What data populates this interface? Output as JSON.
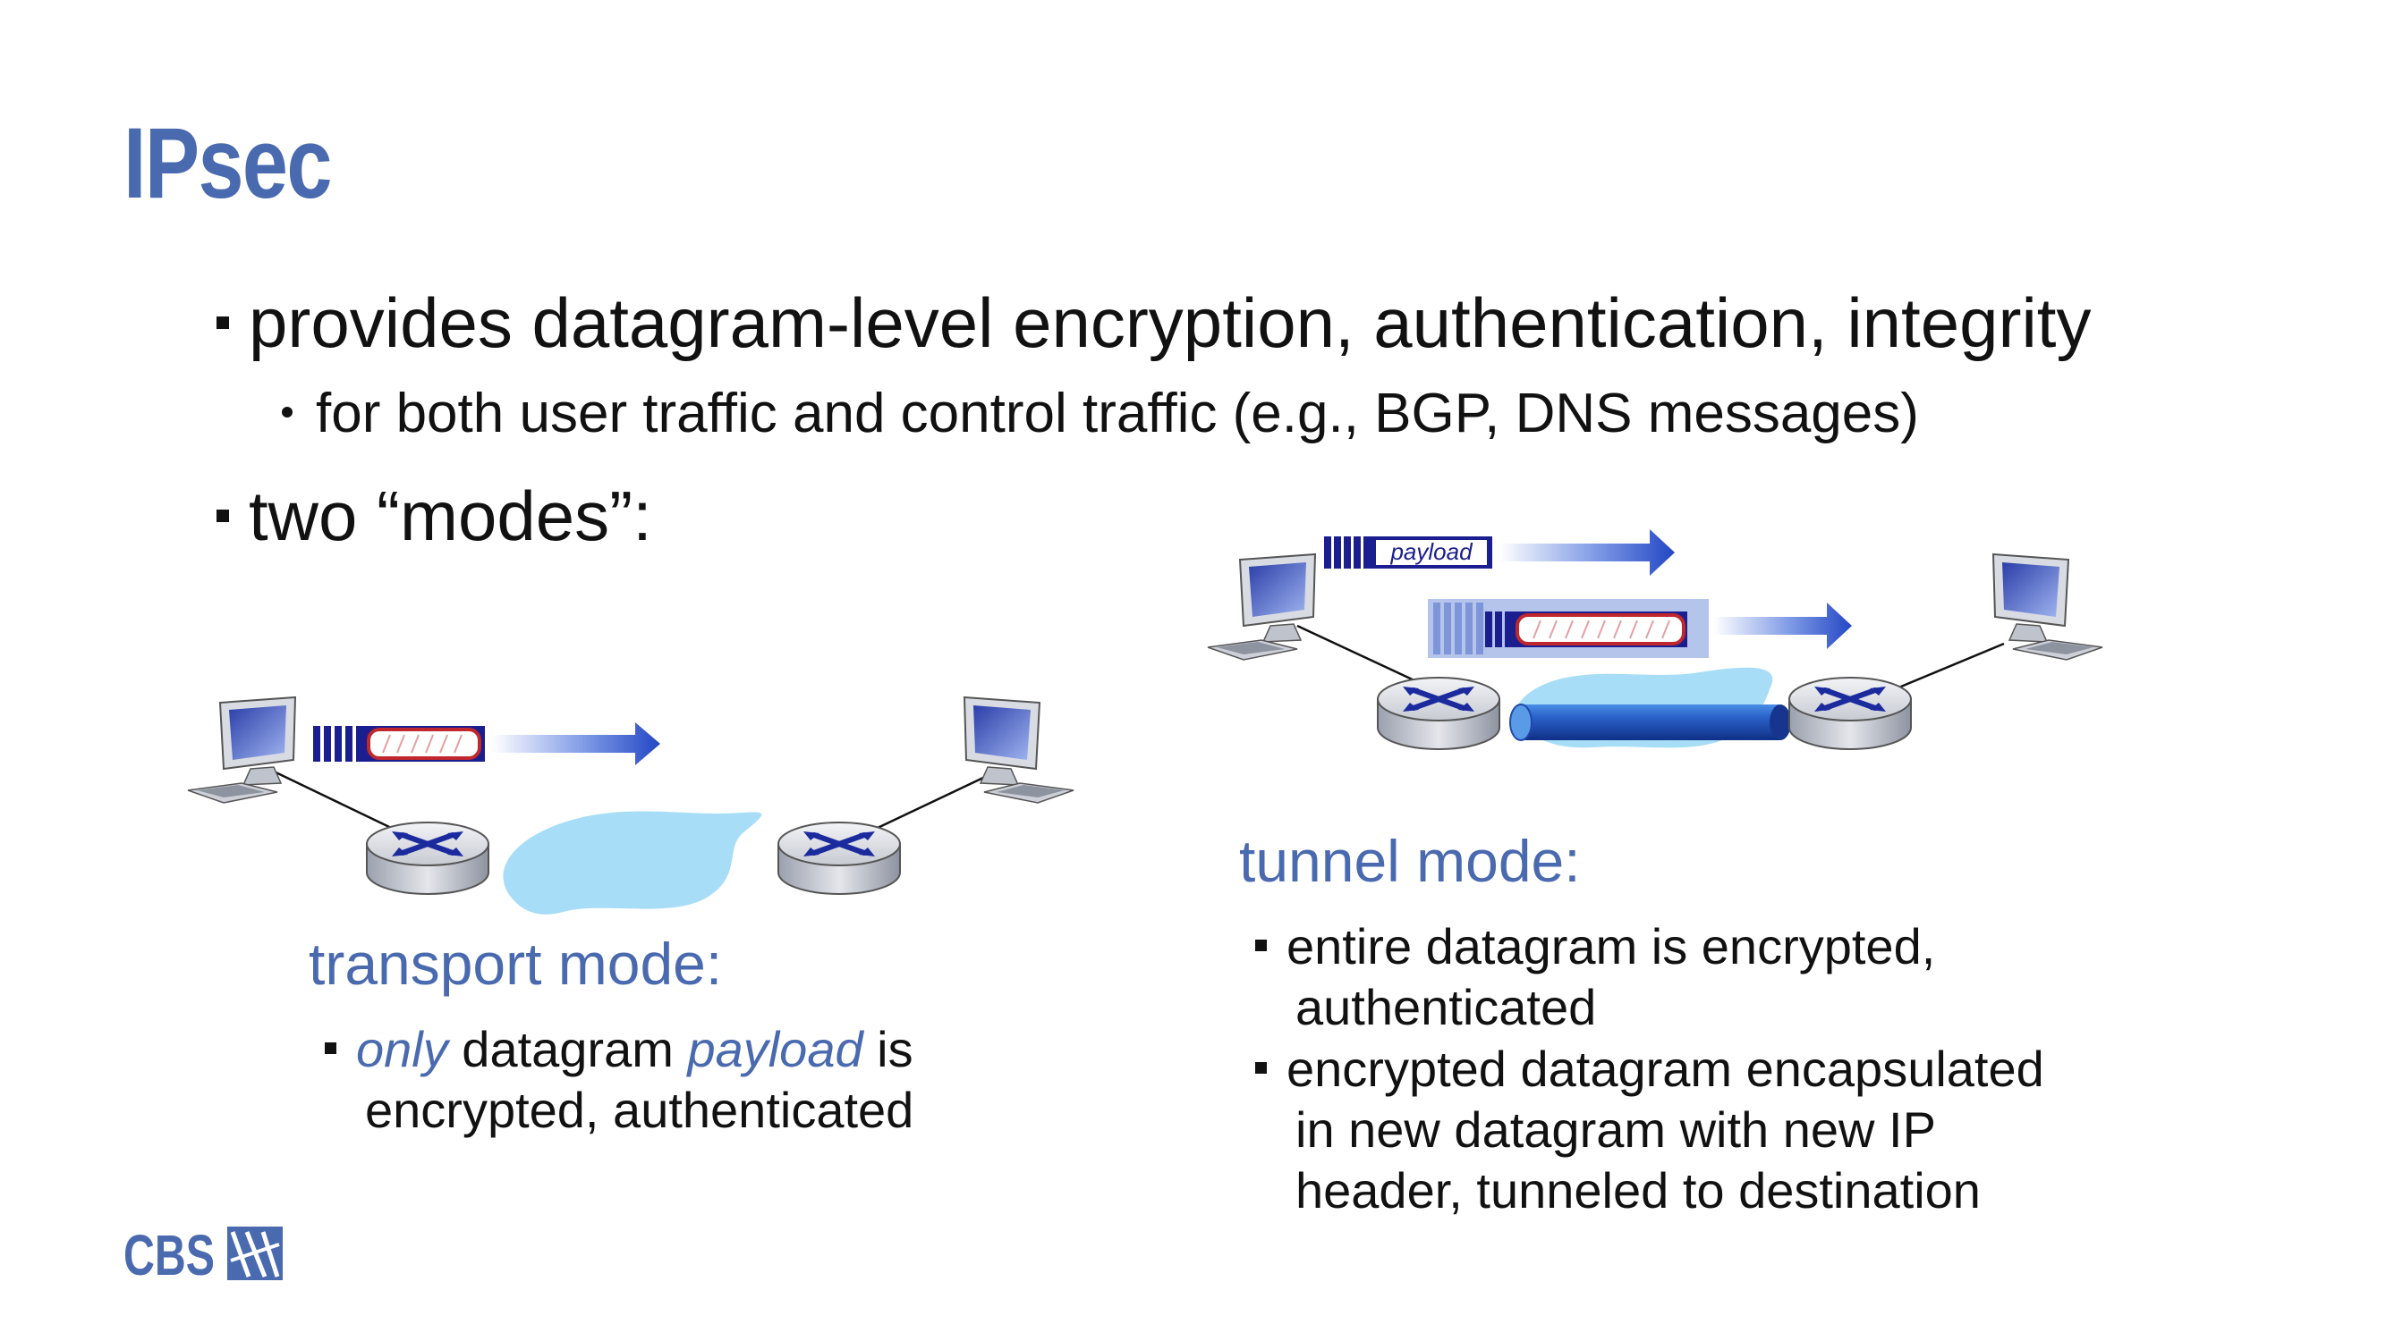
{
  "slide": {
    "title": "IPsec",
    "bullets": [
      "provides datagram-level encryption, authentication, integrity",
      "two “modes”:"
    ],
    "sub_bullet": "for both user traffic and control traffic (e.g., BGP, DNS messages)"
  },
  "transport": {
    "title": "transport mode:",
    "only": "only",
    "datagram": " datagram ",
    "payload": "payload",
    "is": " is",
    "line2": "encrypted, authenticated"
  },
  "tunnel": {
    "title": "tunnel mode:",
    "payload_label": "payload",
    "b1_line1": "entire datagram is encrypted,",
    "b1_line2": "authenticated",
    "b2_line1": "encrypted datagram encapsulated",
    "b2_line2": "in new datagram with new IP",
    "b2_line3": "header, tunneled to destination"
  },
  "logo": {
    "text": "CBS"
  },
  "colors": {
    "title": "#4a6aaf",
    "cloud": "#a7ddf7",
    "header_blue": "#1a1e8e",
    "encrypted_red": "#c0282d",
    "arrow": "#2b4fc4"
  },
  "icons": [
    "computer-icon",
    "router-icon",
    "arrow-right-icon",
    "tunnel-pipe-icon",
    "cloud-network-icon",
    "cbs-logo-icon"
  ]
}
